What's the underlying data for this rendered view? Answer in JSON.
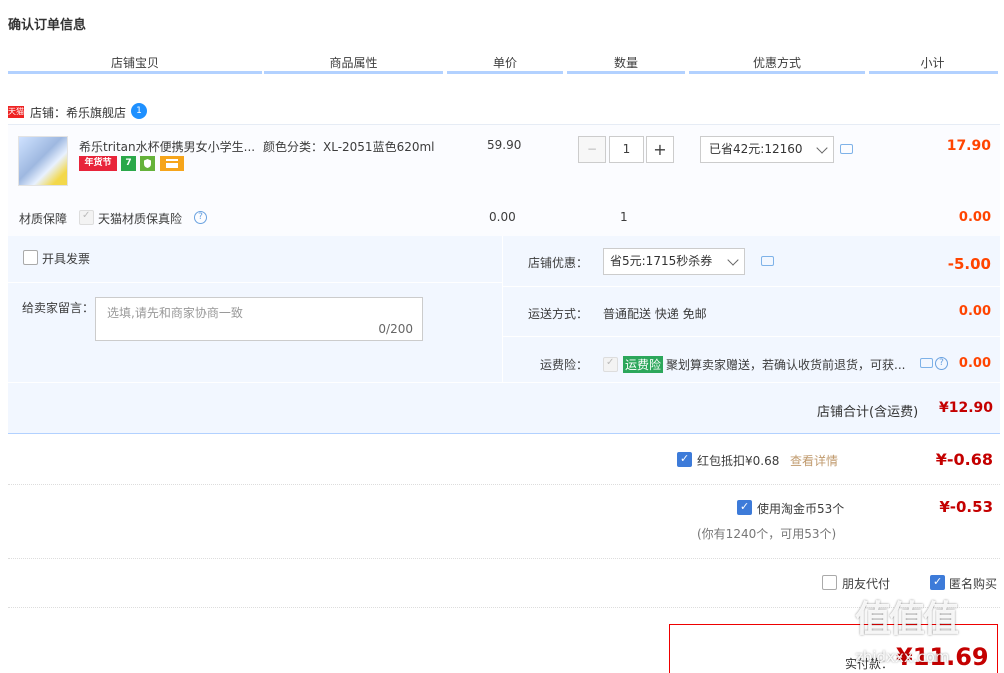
{
  "page_title": "确认订单信息",
  "columns": [
    "店铺宝贝",
    "商品属性",
    "单价",
    "数量",
    "优惠方式",
    "小计"
  ],
  "store": {
    "badge": "天猫",
    "label": "店铺：希乐旗舰店",
    "ww_icon": "1"
  },
  "item": {
    "title": "希乐tritan水杯便携男女小学生...",
    "tags": [
      {
        "label": "年货节",
        "color": "#e8243a"
      },
      {
        "label": "7",
        "color": "#2aa84a"
      },
      {
        "label": "",
        "color": "#65b23a",
        "icon": "shield-icon"
      },
      {
        "label": "",
        "color": "#f6a51b",
        "icon": "card-icon"
      }
    ],
    "sku_label": "颜色分类：XL-2051蓝色620ml",
    "unit_price": "59.90",
    "qty_minus": "−",
    "quantity": "1",
    "qty_plus": "+",
    "discount_selected": "已省42元:12160",
    "subtotal": "17.90"
  },
  "material": {
    "label": "材质保障",
    "option": "天猫材质保真险",
    "help": "?",
    "price": "0.00",
    "qty": "1",
    "subtotal": "0.00"
  },
  "invoice_label": "开具发票",
  "message": {
    "label": "给卖家留言：",
    "placeholder": "选填,请先和商家协商一致",
    "counter": "0/200"
  },
  "shop_discount": {
    "label": "店铺优惠：",
    "selected": "省5元:1715秒杀券",
    "amount": "-5.00"
  },
  "shipping": {
    "label": "运送方式：",
    "value": "普通配送 快递 免邮",
    "amount": "0.00"
  },
  "freight_insurance": {
    "label": "运费险：",
    "badge": "运费险",
    "text": "聚划算卖家赠送，若确认收货前退货，可获...",
    "help": "?",
    "amount": "0.00"
  },
  "store_total": {
    "label": "店铺合计(含运费)",
    "amount": "¥12.90"
  },
  "redpacket": {
    "label": "红包抵扣¥0.68",
    "link": "查看详情",
    "amount": "¥-0.68"
  },
  "taojinbi": {
    "label": "使用淘金币53个",
    "note": "(你有1240个，可用53个)",
    "amount": "¥-0.53"
  },
  "friend_pay": "朋友代付",
  "anonymous": "匿名购买",
  "actual_pay": {
    "label": "实付款：",
    "amount": "¥11.69"
  },
  "watermark": {
    "logo": "值值值",
    "text": "zhidxxx.com"
  },
  "colors": {
    "accent_blue": "#3d7bd9",
    "price_red": "#ff4400",
    "header_line": "#b2d1ff",
    "panel_bg": "#f2f7ff"
  }
}
